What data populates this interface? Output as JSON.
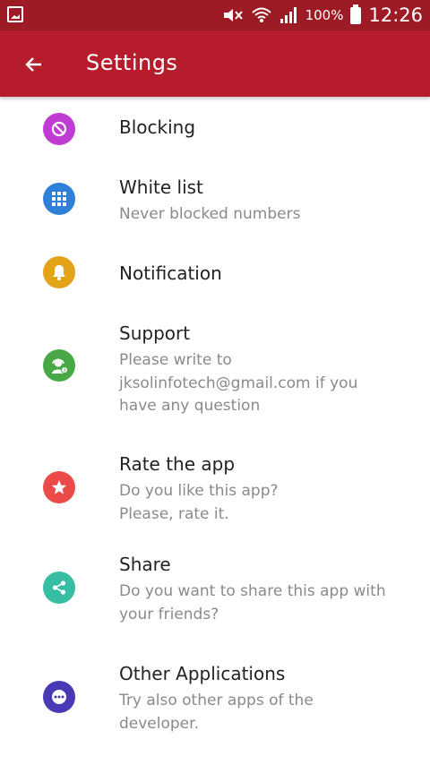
{
  "status_bar": {
    "battery_percent": "100%",
    "time": "12:26",
    "icons": [
      "gallery-notification-icon",
      "mute-icon",
      "wifi-icon",
      "signal-icon",
      "battery-icon"
    ]
  },
  "app_bar": {
    "title": "Settings",
    "back_icon": "arrow-back-icon"
  },
  "colors": {
    "status_bar": "#9d1b25",
    "app_bar": "#b71c2c",
    "blocking": "#c03bd4",
    "white_list": "#2f80d8",
    "notification": "#e3a319",
    "support": "#49a846",
    "rate": "#ea4b49",
    "share": "#37bda4",
    "other_apps": "#4a39b5"
  },
  "settings": [
    {
      "title": "Blocking",
      "subtitle": "",
      "icon": "block-icon"
    },
    {
      "title": "White list",
      "subtitle": "Never blocked numbers",
      "icon": "grid-icon"
    },
    {
      "title": "Notification",
      "subtitle": "",
      "icon": "bell-icon"
    },
    {
      "title": "Support",
      "subtitle": "Please write to\njksolinfotech@gmail.com if you\nhave any question",
      "icon": "support-agent-icon"
    },
    {
      "title": "Rate the app",
      "subtitle": "Do you like this app?\nPlease, rate it.",
      "icon": "star-icon"
    },
    {
      "title": "Share",
      "subtitle": "Do you want to share this app with\nyour friends?",
      "icon": "share-icon"
    },
    {
      "title": "Other Applications",
      "subtitle": "Try also other apps of the\ndeveloper.",
      "icon": "more-icon"
    }
  ]
}
